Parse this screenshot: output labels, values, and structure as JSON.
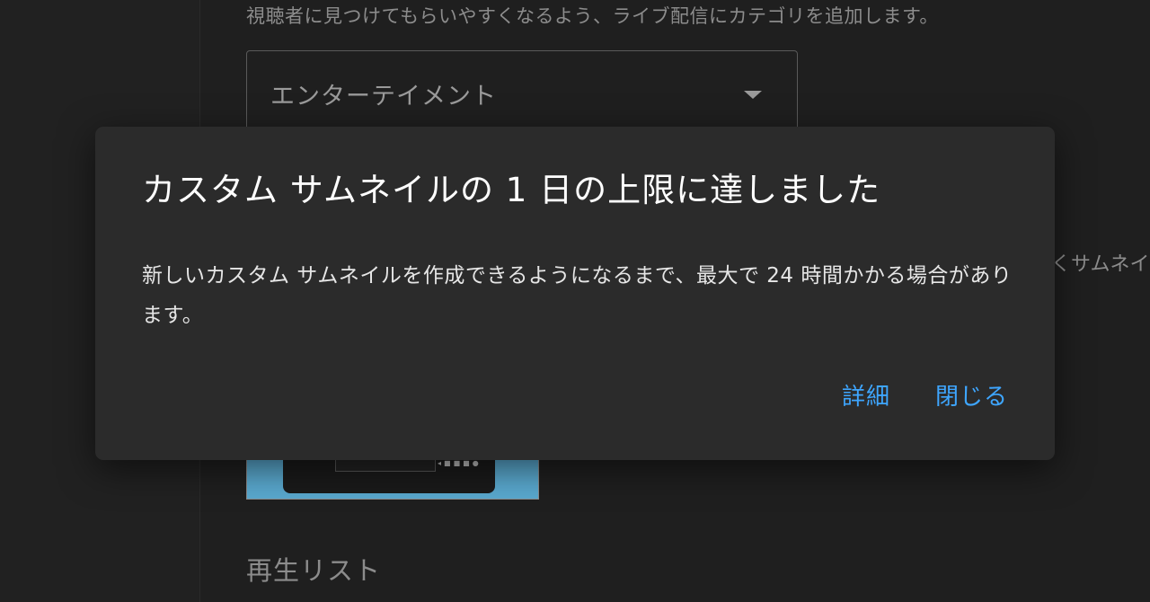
{
  "background": {
    "category_help": "視聴者に見つけてもらいやすくなるよう、ライブ配信にカテゴリを追加します。",
    "category_select": {
      "value": "エンターテイメント"
    },
    "thumbnail_side_text": "くサムネイ",
    "playlist_label": "再生リスト"
  },
  "dialog": {
    "title": "カスタム サムネイルの 1 日の上限に達しました",
    "body": "新しいカスタム サムネイルを作成できるようになるまで、最大で 24 時間かかる場合があります。",
    "actions": {
      "details_label": "詳細",
      "close_label": "閉じる"
    }
  },
  "colors": {
    "accent": "#3ea6ff",
    "dialog_bg": "#2b2b2b",
    "page_bg": "#1f1f1f"
  }
}
